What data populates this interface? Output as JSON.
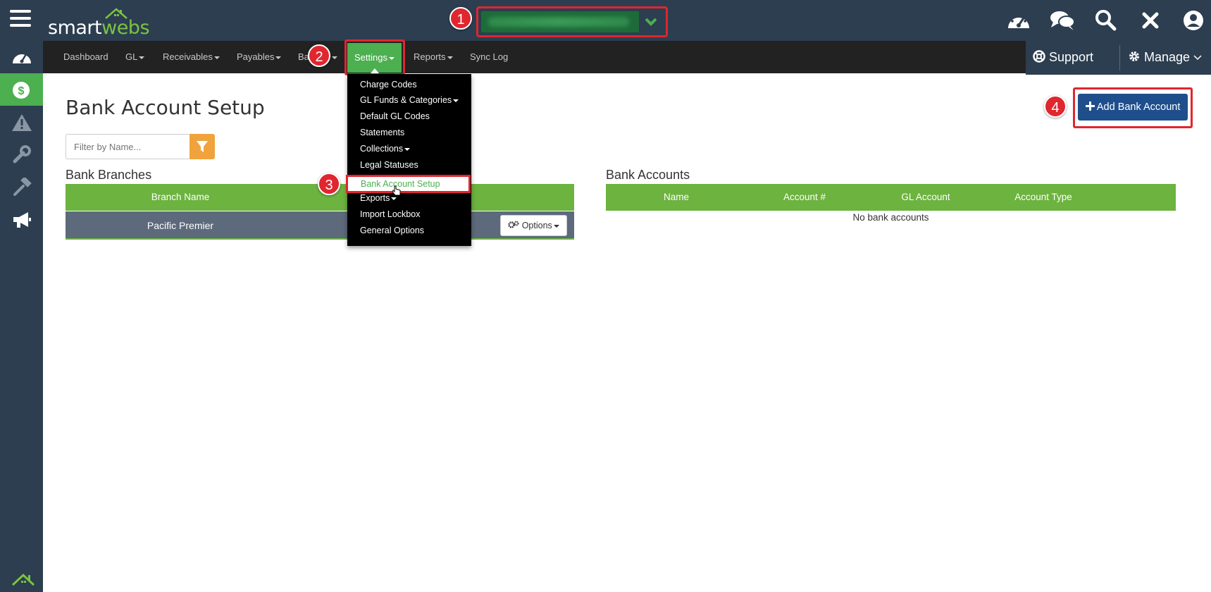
{
  "brand": {
    "part1": "smart",
    "part2": "webs"
  },
  "annotations": {
    "one": "1",
    "two": "2",
    "three": "3",
    "four": "4"
  },
  "nav": {
    "dashboard": "Dashboard",
    "gl": "GL",
    "receivables": "Receivables",
    "payables": "Payables",
    "banking_partial": "Ba",
    "settings": "Settings",
    "reports": "Reports",
    "sync_log": "Sync Log"
  },
  "top_right": {
    "support": "Support",
    "manage": "Manage"
  },
  "settings_menu": {
    "charge_codes": "Charge Codes",
    "gl_funds": "GL Funds & Categories",
    "default_gl": "Default GL Codes",
    "statements": "Statements",
    "collections": "Collections",
    "legal_statuses": "Legal Statuses",
    "bank_account_setup": "Bank Account Setup",
    "exports": "Exports",
    "import_lockbox": "Import Lockbox",
    "general_options": "General Options"
  },
  "page": {
    "title": "Bank Account Setup",
    "filter_placeholder": "Filter by Name...",
    "add_button": "Add Bank Account"
  },
  "branches": {
    "title": "Bank Branches",
    "column": "Branch Name",
    "rows": [
      {
        "name": "Pacific Premier",
        "options": "Options"
      }
    ]
  },
  "accounts": {
    "title": "Bank Accounts",
    "columns": [
      "Name",
      "Account #",
      "GL Account",
      "Account Type"
    ],
    "empty": "No bank accounts"
  },
  "colors": {
    "topbar": "#2c3e50",
    "accent_green": "#6cb33f",
    "annotation_red": "#e0262e",
    "primary_blue": "#1f4e8c",
    "filter_orange": "#f0a33c"
  }
}
